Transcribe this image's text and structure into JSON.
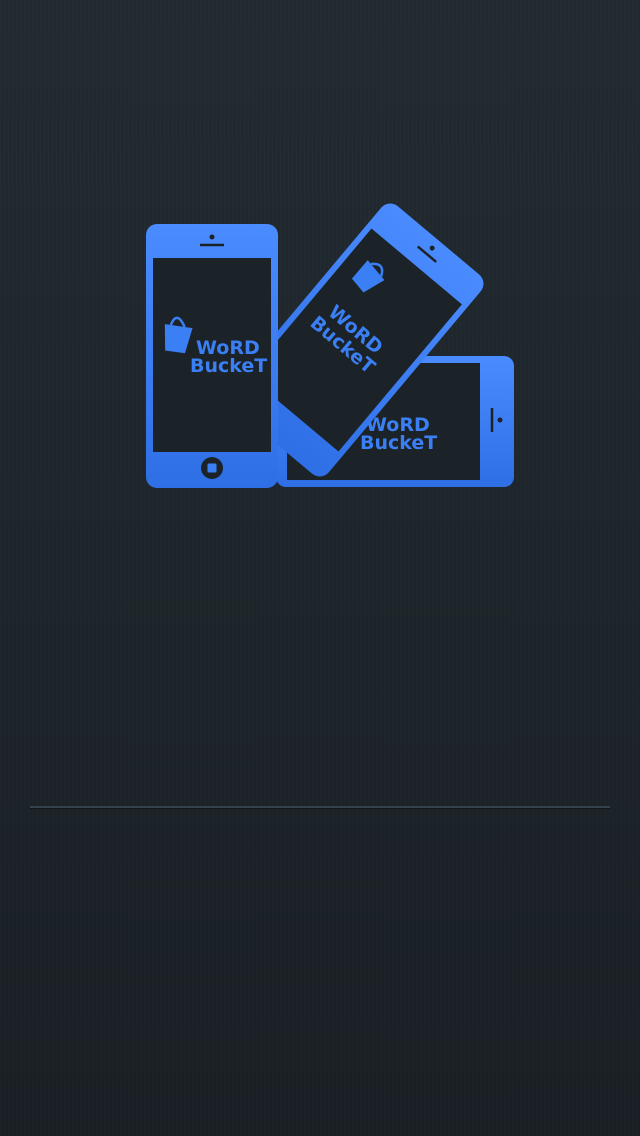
{
  "brand": {
    "name_line1": "WoRD",
    "name_line2": "BuckeT",
    "accent_color": "#3a7ff3",
    "icon": "bucket-icon"
  },
  "background_color": "#1f272d",
  "divider_color": "#33424c"
}
